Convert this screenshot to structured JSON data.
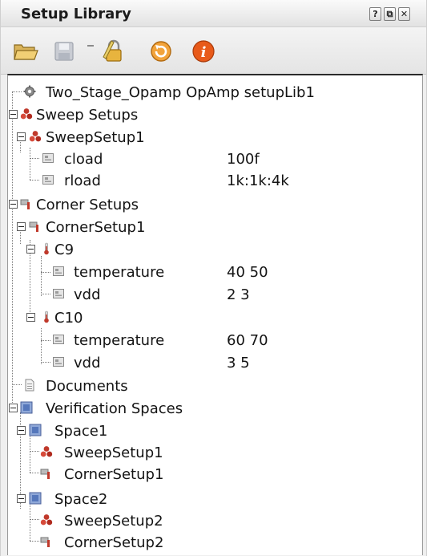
{
  "window": {
    "title": "Setup Library",
    "help_label": "?",
    "float_label": "⧉",
    "close_label": "✕"
  },
  "toolbar": {
    "buttons": [
      "open-folder-icon",
      "save-disk-icon",
      "separator",
      "lock-edit-icon",
      "refresh-icon",
      "info-icon"
    ],
    "info_label": "i"
  },
  "tree": {
    "root_label": "Two_Stage_Opamp OpAmp setupLib1",
    "sweep_setups_label": "Sweep Setups",
    "sweep_setup1_label": "SweepSetup1",
    "cload_label": "cload",
    "cload_value": "100f",
    "rload_label": "rload",
    "rload_value": "1k:1k:4k",
    "corner_setups_label": "Corner Setups",
    "corner_setup1_label": "CornerSetup1",
    "c9_label": "C9",
    "c9_temp_label": "temperature",
    "c9_temp_value": "40 50",
    "c9_vdd_label": "vdd",
    "c9_vdd_value": "2 3",
    "c10_label": "C10",
    "c10_temp_label": "temperature",
    "c10_temp_value": "60 70",
    "c10_vdd_label": "vdd",
    "c10_vdd_value": "3 5",
    "documents_label": "Documents",
    "verification_spaces_label": "Verification Spaces",
    "space1_label": "Space1",
    "space1_sweep_label": "SweepSetup1",
    "space1_corner_label": "CornerSetup1",
    "space2_label": "Space2",
    "space2_sweep_label": "SweepSetup2",
    "space2_corner_label": "CornerSetup2"
  },
  "colors": {
    "accent_red": "#c0392b",
    "space_blue": "#5577bb",
    "info_orange": "#e85a1a",
    "refresh_orange": "#f2a33a"
  }
}
